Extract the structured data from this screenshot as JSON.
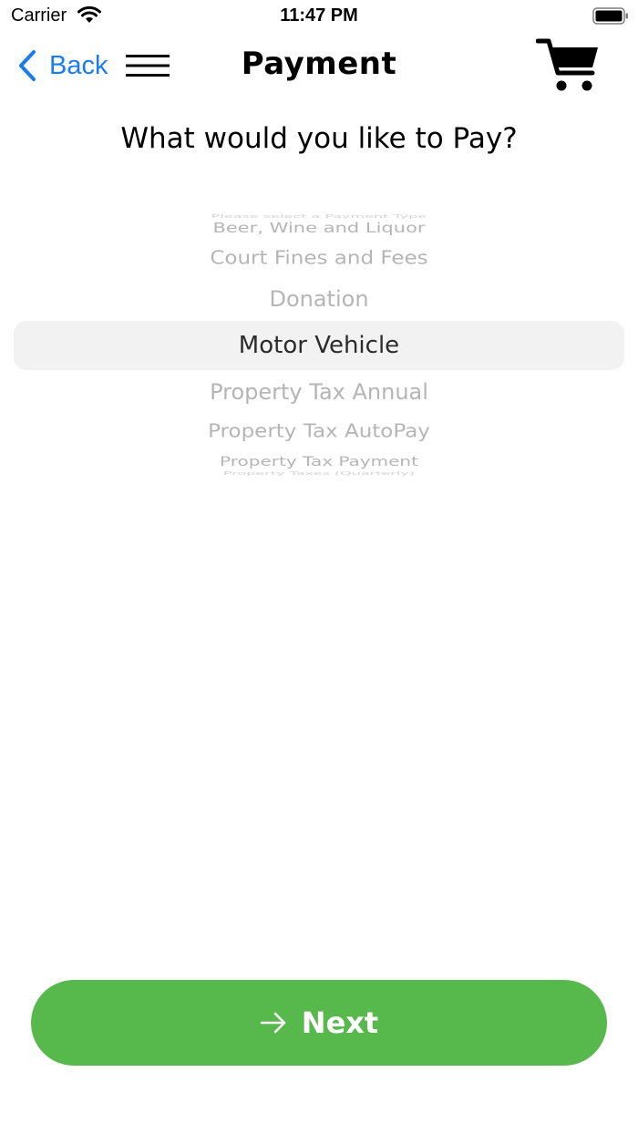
{
  "status_bar": {
    "carrier": "Carrier",
    "time": "11:47 PM",
    "icons": [
      "wifi-icon",
      "battery-icon"
    ]
  },
  "nav": {
    "back_label": "Back",
    "title": "Payment",
    "icons": [
      "chevron-left-icon",
      "hamburger-menu-icon",
      "cart-icon"
    ]
  },
  "question": "What would you like to Pay?",
  "picker": {
    "options": [
      "Please select a Payment Type",
      "Beer, Wine and Liquor",
      "Court Fines and Fees",
      "Donation",
      "Motor Vehicle",
      "Property Tax Annual",
      "Property Tax AutoPay",
      "Property Tax Payment",
      "Property Taxes (Quarterly)"
    ],
    "selected": "Motor Vehicle"
  },
  "next_button": {
    "label": "Next",
    "icon": "arrow-right-icon"
  },
  "colors": {
    "accent_blue": "#1a7cf0",
    "next_green": "#57b84c",
    "picker_text": "#b5b5b5",
    "picker_selected_text": "#2b2b2b",
    "picker_highlight": "#f2f2f2"
  }
}
